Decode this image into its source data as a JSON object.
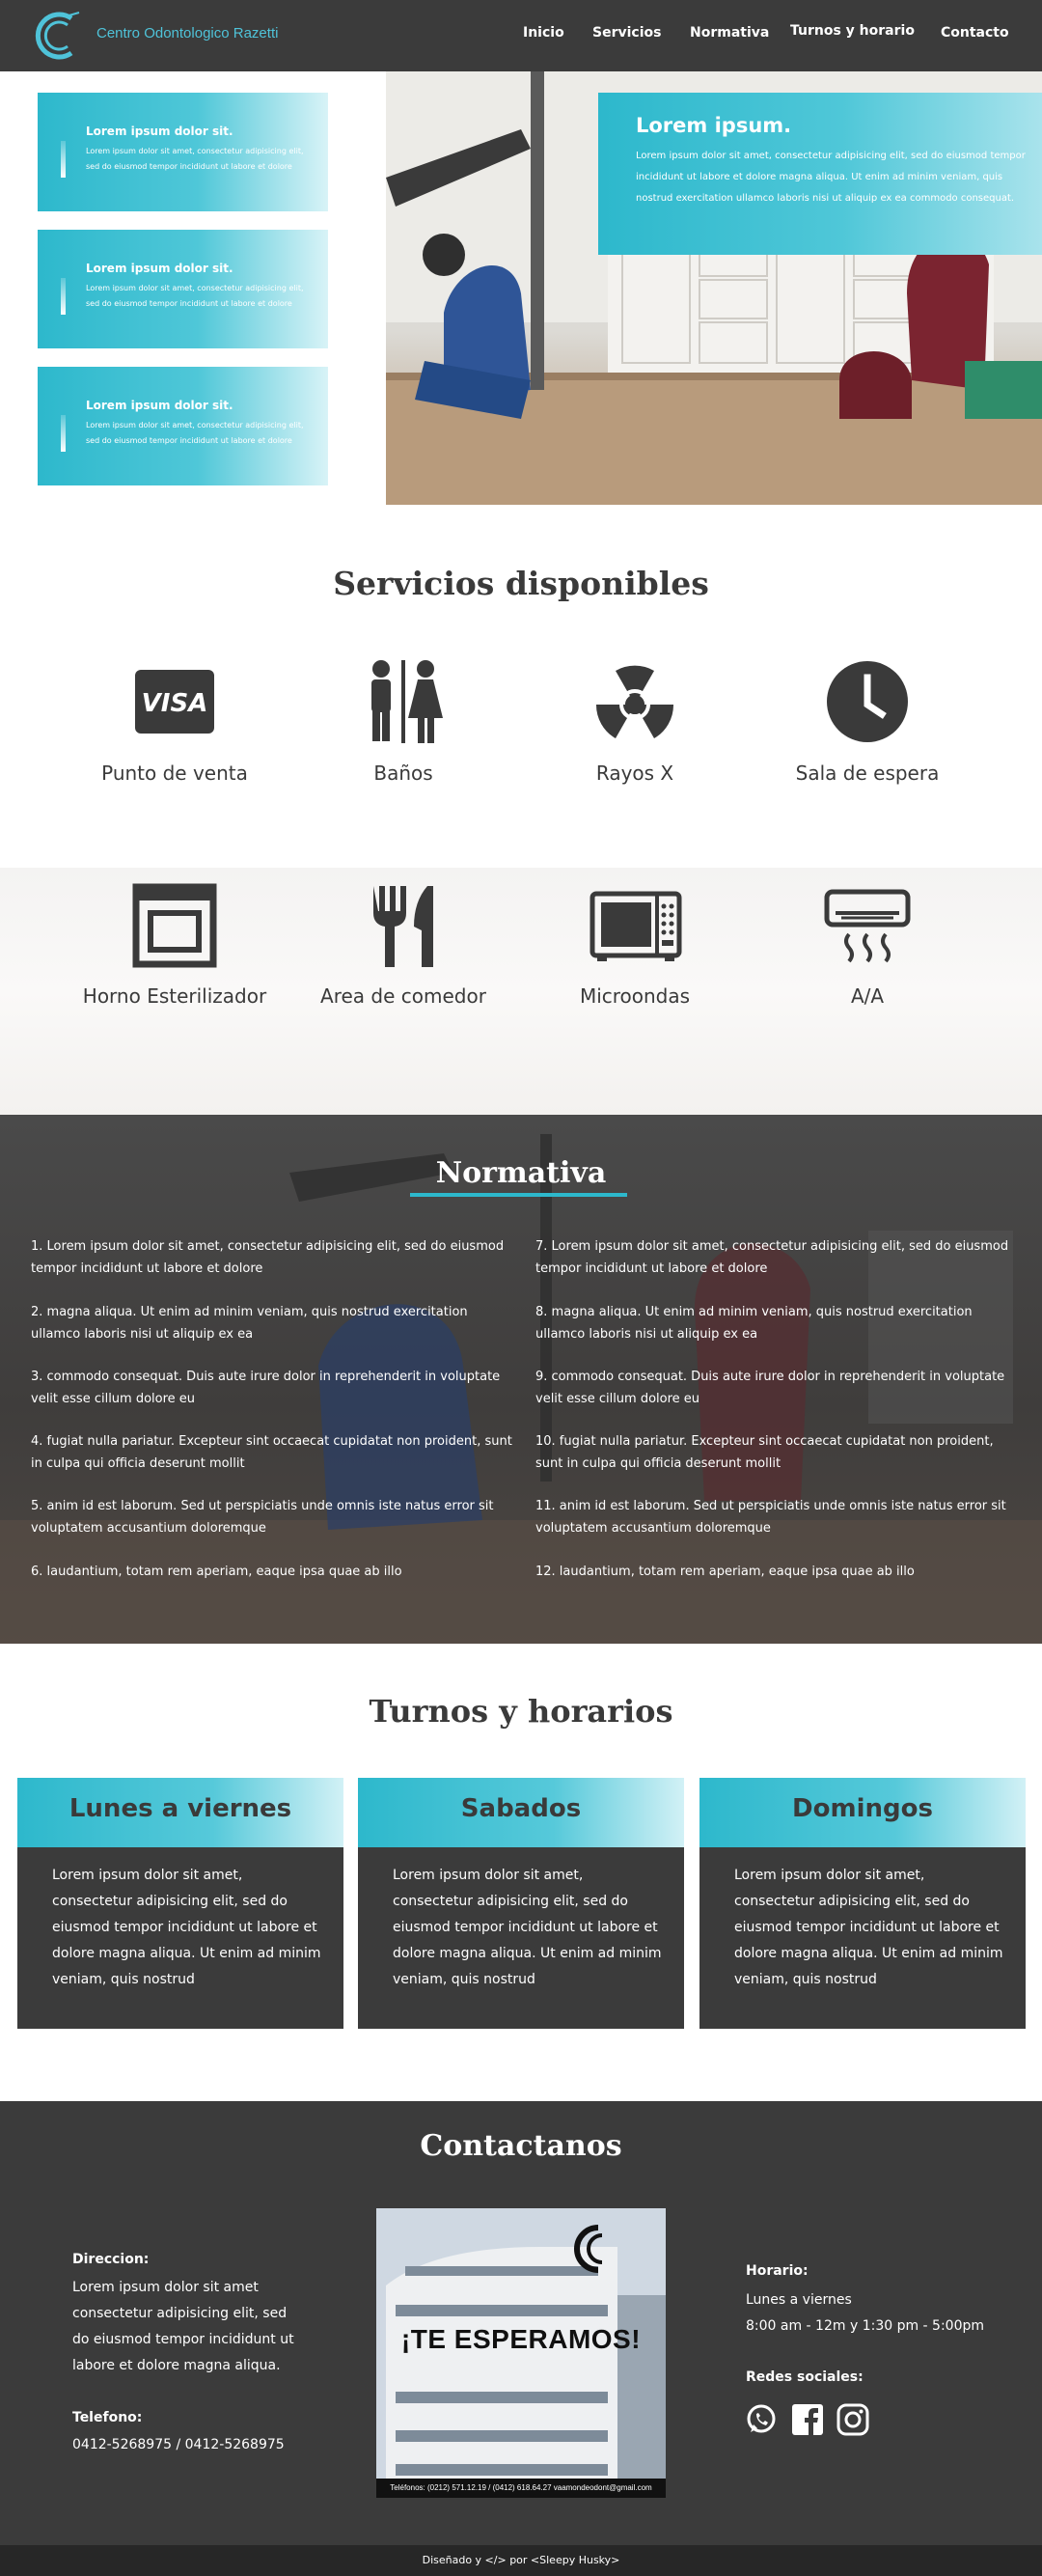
{
  "nav": {
    "brand": "Centro Odontologico Razetti",
    "links": [
      "Inicio",
      "Servicios",
      "Normativa",
      "Turnos y horario",
      "Contacto"
    ]
  },
  "hero": {
    "cards": [
      {
        "title": "Lorem ipsum dolor sit.",
        "text": "Lorem ipsum dolor sit amet, consectetur adipisicing elit, sed do eiusmod tempor incididunt ut labore et dolore"
      },
      {
        "title": "Lorem ipsum dolor sit.",
        "text": "Lorem ipsum dolor sit amet, consectetur adipisicing elit, sed do eiusmod tempor incididunt ut labore et dolore"
      },
      {
        "title": "Lorem ipsum dolor sit.",
        "text": "Lorem ipsum dolor sit amet, consectetur adipisicing elit, sed do eiusmod tempor incididunt ut labore et dolore"
      }
    ],
    "overlay_title": "Lorem ipsum.",
    "overlay_text": "Lorem ipsum dolor sit amet, consectetur adipisicing elit, sed do eiusmod tempor incididunt ut labore et dolore magna aliqua. Ut enim ad minim veniam, quis nostrud exercitation ullamco laboris nisi ut aliquip ex ea commodo consequat."
  },
  "services": {
    "title": "Servicios disponibles",
    "items": [
      {
        "label": "Punto de venta",
        "icon": "visa-card-icon"
      },
      {
        "label": "Baños",
        "icon": "restroom-icon"
      },
      {
        "label": "Rayos X",
        "icon": "radiation-icon"
      },
      {
        "label": "Sala de espera",
        "icon": "clock-icon"
      },
      {
        "label": "Horno Esterilizador",
        "icon": "oven-icon"
      },
      {
        "label": "Area de comedor",
        "icon": "utensils-icon"
      },
      {
        "label": "Microondas",
        "icon": "microwave-icon"
      },
      {
        "label": "A/A",
        "icon": "air-conditioner-icon"
      }
    ]
  },
  "normativa": {
    "title": "Normativa",
    "items": [
      "1. Lorem ipsum dolor sit amet, consectetur adipisicing elit, sed do eiusmod tempor incididunt ut labore et dolore",
      "2. magna aliqua. Ut enim ad minim veniam, quis nostrud exercitation ullamco laboris nisi ut aliquip ex ea",
      "3. commodo consequat. Duis aute irure dolor in reprehenderit in voluptate velit esse cillum dolore eu",
      "4. fugiat nulla pariatur. Excepteur sint occaecat cupidatat non proident, sunt in culpa qui officia deserunt mollit",
      "5. anim id est laborum. Sed ut perspiciatis unde omnis iste natus error sit voluptatem accusantium doloremque",
      "6. laudantium, totam rem aperiam, eaque ipsa quae ab illo",
      "7. Lorem ipsum dolor sit amet, consectetur adipisicing elit, sed do eiusmod tempor incididunt ut labore et dolore",
      "8. magna aliqua. Ut enim ad minim veniam, quis nostrud exercitation ullamco laboris nisi ut aliquip ex ea",
      "9. commodo consequat. Duis aute irure dolor in reprehenderit in voluptate velit esse cillum dolore eu",
      "10. fugiat nulla pariatur. Excepteur sint occaecat cupidatat non proident, sunt in culpa qui officia deserunt mollit",
      "11. anim id est laborum. Sed ut perspiciatis unde omnis iste natus error sit voluptatem accusantium doloremque",
      "12. laudantium, totam rem aperiam, eaque ipsa quae ab illo"
    ]
  },
  "turnos": {
    "title": "Turnos y horarios",
    "cards": [
      {
        "title": "Lunes a viernes",
        "text": "Lorem ipsum dolor sit amet, consectetur adipisicing elit, sed do eiusmod tempor incididunt ut labore et dolore magna aliqua. Ut enim ad minim veniam, quis nostrud"
      },
      {
        "title": "Sabados",
        "text": "Lorem ipsum dolor sit amet, consectetur adipisicing elit, sed do eiusmod tempor incididunt ut labore et dolore magna aliqua. Ut enim ad minim veniam, quis nostrud"
      },
      {
        "title": "Domingos",
        "text": "Lorem ipsum dolor sit amet, consectetur adipisicing elit, sed do eiusmod tempor incididunt ut labore et dolore magna aliqua. Ut enim ad minim veniam, quis nostrud"
      }
    ]
  },
  "contact": {
    "title": "Contactanos",
    "direccion_label": "Direccion:",
    "direccion_text": "Lorem ipsum dolor sit amet consectetur adipisicing elit, sed do eiusmod tempor incididunt ut labore et dolore magna aliqua.",
    "telefono_label": "Telefono:",
    "telefono_text": "0412-5268975 / 0412-5268975",
    "poster_text": "¡TE ESPERAMOS!",
    "poster_footer": "Teléfonos: (0212) 571.12.19 / (0412) 618.64.27   vaamondeodont@gmail.com",
    "horario_label": "Horario:",
    "horario_days": "Lunes a viernes",
    "horario_hours": "8:00 am - 12m y 1:30 pm - 5:00pm",
    "redes_label": "Redes sociales:",
    "social_icons": [
      "whatsapp-icon",
      "facebook-icon",
      "instagram-icon"
    ]
  },
  "footer": {
    "text": "Diseñado y </> por <Sleepy Husky>"
  },
  "colors": {
    "accent": "#2db8cc",
    "dark": "#3b3b3b",
    "footer": "#272727"
  }
}
